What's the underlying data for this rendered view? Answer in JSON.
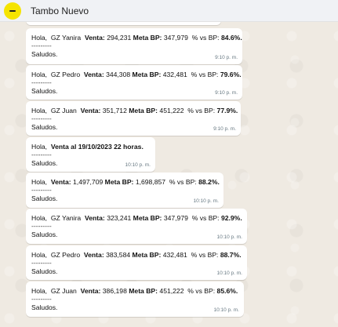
{
  "header": {
    "title": "Tambo Nuevo"
  },
  "messages": [
    {
      "greeting": "Hola,",
      "name": "GZ Yanira",
      "venta_label": "Venta:",
      "venta": "294,231",
      "meta_label": "Meta BP:",
      "meta": "347,979",
      "pct_label": "% vs BP:",
      "pct": "84.6%.",
      "sep": "---------",
      "closing": "Saludos.",
      "time": "9:10 p. m."
    },
    {
      "greeting": "Hola,",
      "name": "GZ Pedro",
      "venta_label": "Venta:",
      "venta": "344,308",
      "meta_label": "Meta BP:",
      "meta": "432,481",
      "pct_label": "% vs BP:",
      "pct": "79.6%.",
      "sep": "---------",
      "closing": "Saludos.",
      "time": "9:10 p. m."
    },
    {
      "greeting": "Hola,",
      "name": "GZ Juan",
      "venta_label": "Venta:",
      "venta": "351,712",
      "meta_label": "Meta BP:",
      "meta": "451,222",
      "pct_label": "% vs BP:",
      "pct": "77.9%.",
      "sep": "---------",
      "closing": "Saludos.",
      "time": "9:10 p. m."
    },
    {
      "greeting": "Hola,",
      "headline": "Venta al 19/10/2023  22 horas.",
      "sep": "---------",
      "closing": "Saludos.",
      "time": "10:10 p. m."
    },
    {
      "greeting": "Hola,",
      "venta_label": "Venta:",
      "venta": "1,497,709",
      "meta_label": "Meta BP:",
      "meta": "1,698,857",
      "pct_label": "% vs BP:",
      "pct": "88.2%.",
      "sep": "---------",
      "closing": "Saludos.",
      "time": "10:10 p. m."
    },
    {
      "greeting": "Hola,",
      "name": "GZ Yanira",
      "venta_label": "Venta:",
      "venta": "323,241",
      "meta_label": "Meta BP:",
      "meta": "347,979",
      "pct_label": "% vs BP:",
      "pct": "92.9%.",
      "sep": "---------",
      "closing": "Saludos.",
      "time": "10:10 p. m."
    },
    {
      "greeting": "Hola,",
      "name": "GZ Pedro",
      "venta_label": "Venta:",
      "venta": "383,584",
      "meta_label": "Meta BP:",
      "meta": "432,481",
      "pct_label": "% vs BP:",
      "pct": "88.7%.",
      "sep": "---------",
      "closing": "Saludos.",
      "time": "10:10 p. m."
    },
    {
      "greeting": "Hola,",
      "name": "GZ Juan",
      "venta_label": "Venta:",
      "venta": "386,198",
      "meta_label": "Meta BP:",
      "meta": "451,222",
      "pct_label": "% vs BP:",
      "pct": "85.6%.",
      "sep": "---------",
      "closing": "Saludos.",
      "time": "10:10 p. m."
    }
  ]
}
